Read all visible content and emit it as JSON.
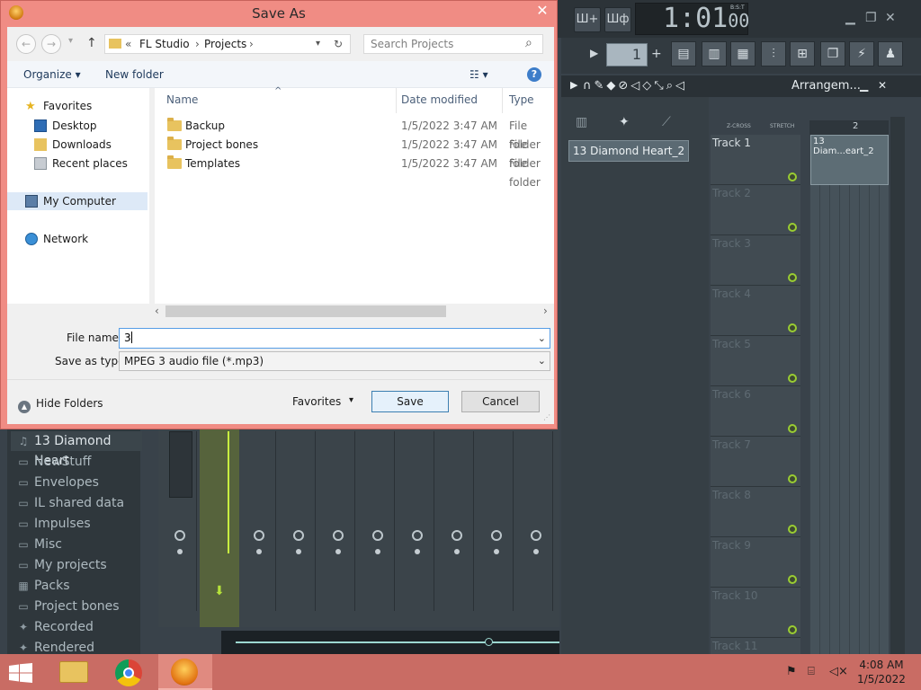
{
  "dialog": {
    "title": "Save As",
    "close_glyph": "✕",
    "nav": {
      "back": "←",
      "forward": "→",
      "up": "↑"
    },
    "breadcrumb": {
      "chevron": "«",
      "items": [
        "FL Studio",
        "Projects"
      ],
      "sep": "›",
      "dropdown": "▾",
      "refresh": "↻"
    },
    "search": {
      "placeholder": "Search Projects",
      "icon": "⌕"
    },
    "toolbar": {
      "organize": "Organize ▾",
      "new_folder": "New folder",
      "view": "☷ ▾",
      "help": "?"
    },
    "navpane": {
      "items": [
        {
          "label": "Favorites",
          "icon": "star-icon"
        },
        {
          "label": "Desktop",
          "icon": "desktop-icon"
        },
        {
          "label": "Downloads",
          "icon": "downloads-icon"
        },
        {
          "label": "Recent places",
          "icon": "recent-places-icon"
        },
        {
          "label": "My Computer",
          "icon": "computer-icon"
        },
        {
          "label": "Network",
          "icon": "network-icon"
        }
      ]
    },
    "columns": {
      "name": "Name",
      "date": "Date modified",
      "type": "Type",
      "sort_glyph": "^"
    },
    "files": [
      {
        "name": "Backup",
        "date": "1/5/2022 3:47 AM",
        "type": "File folder"
      },
      {
        "name": "Project bones",
        "date": "1/5/2022 3:47 AM",
        "type": "File folder"
      },
      {
        "name": "Templates",
        "date": "1/5/2022 3:47 AM",
        "type": "File folder"
      }
    ],
    "scroll": {
      "left": "‹",
      "right": "›"
    },
    "file_name_label": "File name:",
    "file_name_value": "3",
    "save_type_label": "Save as type:",
    "save_type_value": "MPEG 3 audio file (*.mp3)",
    "dropdown_glyph": "⌄",
    "hide_folders": "Hide Folders",
    "hide_folders_glyph": "▲",
    "favorites_label": "Favorites",
    "favorites_glyph": "▾",
    "save_button": "Save",
    "cancel_button": "Cancel"
  },
  "fl": {
    "time": "1:01",
    "time_small": "00",
    "bst": "B:S:T",
    "pattern_number": "1",
    "pattern_plus": "+",
    "win_controls": {
      "minimize": "▁",
      "restore": "❐",
      "close": "✕"
    },
    "playlist_title": "Arrangem...",
    "playlist_controls": {
      "minimize": "▁",
      "close": "✕"
    },
    "playlist_labels": {
      "zcross": "Z-CROSS",
      "stretch": "STRETCH"
    },
    "ruler_mark": "2",
    "clip_name": "13 Diamond Heart_2",
    "grid_clip_name": "13 Diam...eart_2",
    "tracks": [
      "Track 1",
      "Track 2",
      "Track 3",
      "Track 4",
      "Track 5",
      "Track 6",
      "Track 7",
      "Track 8",
      "Track 9",
      "Track 10",
      "Track 11"
    ],
    "browser_items": [
      {
        "label": "13 Diamond Heart",
        "icon": "mp3-file-icon"
      },
      {
        "label": "NewStuff",
        "icon": "folder-icon"
      },
      {
        "label": "Envelopes",
        "icon": "folder-icon"
      },
      {
        "label": "IL shared data",
        "icon": "folder-icon"
      },
      {
        "label": "Impulses",
        "icon": "folder-icon"
      },
      {
        "label": "Misc",
        "icon": "folder-icon"
      },
      {
        "label": "My projects",
        "icon": "folder-icon"
      },
      {
        "label": "Packs",
        "icon": "packs-icon"
      },
      {
        "label": "Project bones",
        "icon": "folder-icon"
      },
      {
        "label": "Recorded",
        "icon": "recorded-icon"
      },
      {
        "label": "Rendered",
        "icon": "rendered-icon"
      }
    ]
  },
  "taskbar": {
    "time": "4:08 AM",
    "date": "1/5/2022"
  }
}
